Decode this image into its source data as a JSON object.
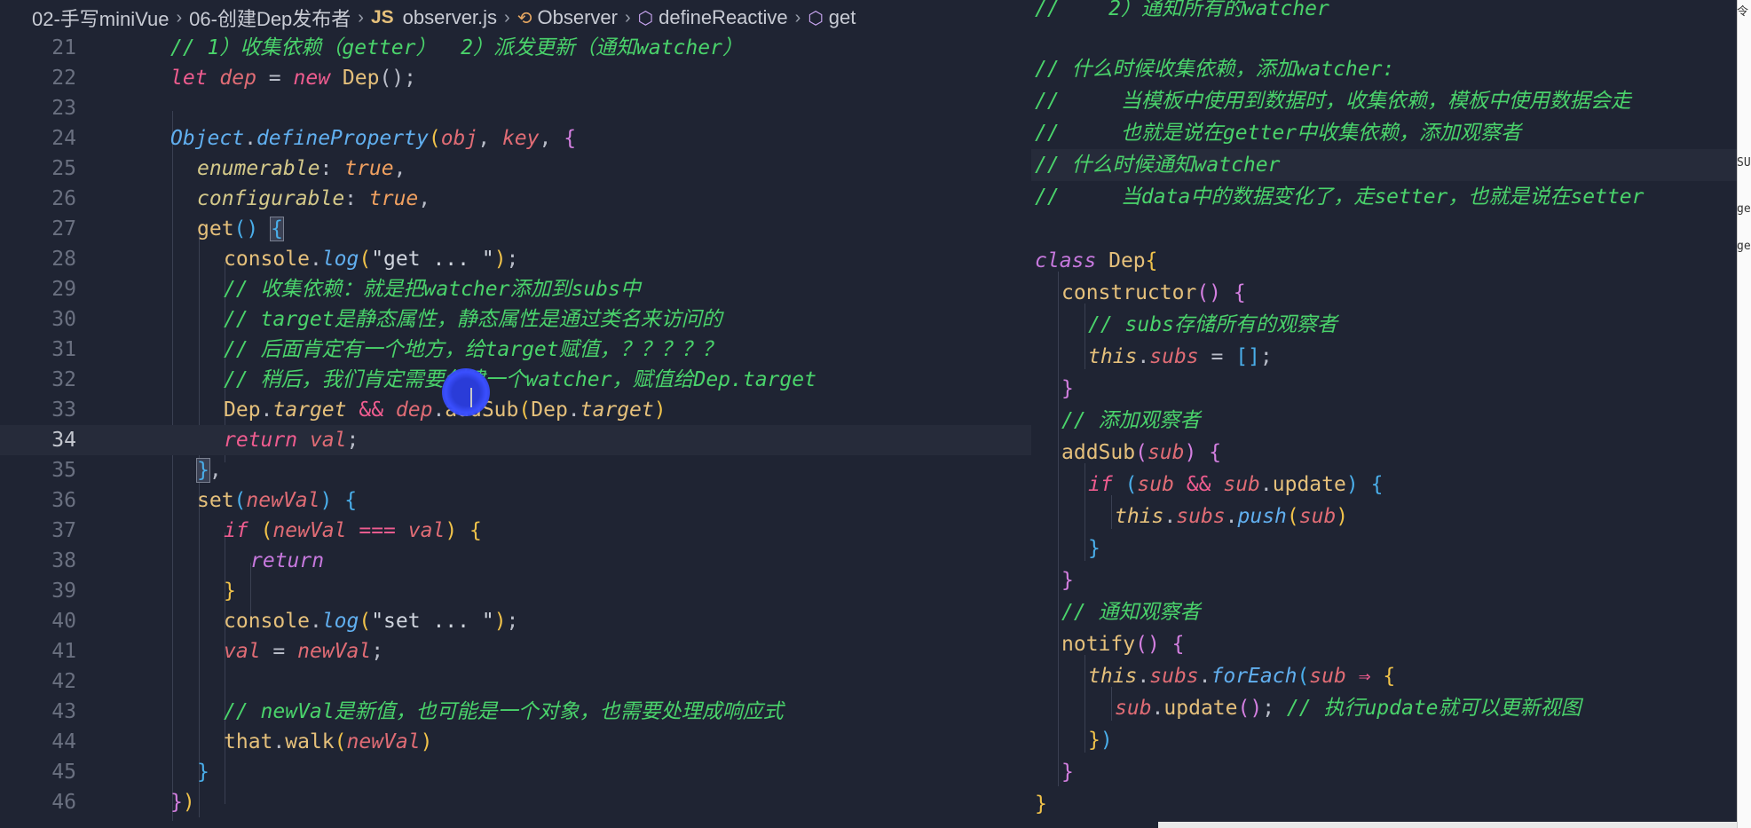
{
  "breadcrumb": {
    "folder1": "02-手写miniVue",
    "folder2": "06-创建Dep发布者",
    "file_badge": "JS",
    "file": "observer.js",
    "symbol1": "Observer",
    "symbol2": "defineReactive",
    "symbol3": "get"
  },
  "left_lines": [
    {
      "num": "21"
    },
    {
      "num": "22"
    },
    {
      "num": "23"
    },
    {
      "num": "24"
    },
    {
      "num": "25"
    },
    {
      "num": "26"
    },
    {
      "num": "27"
    },
    {
      "num": "28"
    },
    {
      "num": "29"
    },
    {
      "num": "30"
    },
    {
      "num": "31"
    },
    {
      "num": "32"
    },
    {
      "num": "33"
    },
    {
      "num": "34"
    },
    {
      "num": "35"
    },
    {
      "num": "36"
    },
    {
      "num": "37"
    },
    {
      "num": "38"
    },
    {
      "num": "39"
    },
    {
      "num": "40"
    },
    {
      "num": "41"
    },
    {
      "num": "42"
    },
    {
      "num": "43"
    },
    {
      "num": "44"
    },
    {
      "num": "45"
    },
    {
      "num": "46"
    }
  ],
  "code_left": {
    "l21_comment": "// 1）收集依赖（getter）  2）派发更新（通知watcher）",
    "l22_let": "let",
    "l22_dep": "dep",
    "l22_eq": " = ",
    "l22_new": "new",
    "l22_cls": "Dep",
    "l22_tail": "();",
    "l24_obj": "Object",
    "l24_dot": ".",
    "l24_fn": "defineProperty",
    "l24_arg1": "obj",
    "l24_comma": ", ",
    "l24_arg2": "key",
    "l25_key": "enumerable",
    "l25_val": "true",
    "l26_key": "configurable",
    "l26_val": "true",
    "l27_fn": "get",
    "l28_obj": "console",
    "l28_fn": "log",
    "l28_str": "\"get ... \"",
    "l29_comment": "// 收集依赖：就是把watcher添加到subs中",
    "l30_comment": "// target是静态属性，静态属性是通过类名来访问的",
    "l31_comment": "// 后面肯定有一个地方，给target赋值，？？？？？",
    "l32_comment": "// 稍后，我们肯定需要创建一个watcher，赋值给Dep.target",
    "l33_cls": "Dep",
    "l33_prop": "target",
    "l33_and": " && ",
    "l33_dep": "dep",
    "l33_fn": "addSub",
    "l33_cls2": "Dep",
    "l33_prop2": "target",
    "l34_kw": "return",
    "l34_val": "val",
    "l36_fn": "set",
    "l36_par": "newVal",
    "l37_kw": "if",
    "l37_a": "newVal",
    "l37_op": " === ",
    "l37_b": "val",
    "l38_kw": "return",
    "l40_obj": "console",
    "l40_fn": "log",
    "l40_str": "\"set ... \"",
    "l41_a": "val",
    "l41_b": "newVal",
    "l43_comment": "// newVal是新值，也可能是一个对象，也需要处理成响应式",
    "l44_obj": "that",
    "l44_fn": "walk",
    "l44_par": "newVal"
  },
  "code_right": {
    "r1_comment": "//    2）通知所有的watcher",
    "r3_comment": "// 什么时候收集依赖，添加watcher:",
    "r4_comment": "//     当模板中使用到数据时，收集依赖，模板中使用数据会走",
    "r5_comment": "//     也就是说在getter中收集依赖，添加观察者",
    "r6_comment": "// 什么时候通知watcher",
    "r7_comment": "//     当data中的数据变化了，走setter，也就是说在setter",
    "r9_kw": "class",
    "r9_cls": "Dep",
    "r10_fn": "constructor",
    "r11_comment": "// subs存储所有的观察者",
    "r12_this": "this",
    "r12_prop": "subs",
    "r14_comment": "// 添加观察者",
    "r15_fn": "addSub",
    "r15_par": "sub",
    "r16_kw": "if",
    "r16_a": "sub",
    "r16_b": "sub",
    "r16_prop": "update",
    "r17_this": "this",
    "r17_prop": "subs",
    "r17_fn": "push",
    "r17_par": "sub",
    "r20_comment": "// 通知观察者",
    "r21_fn": "notify",
    "r22_this": "this",
    "r22_prop": "subs",
    "r22_fn": "forEach",
    "r22_par": "sub",
    "r23_a": "sub",
    "r23_fn": "update",
    "r23_comment": "// 执行update就可以更新视图"
  },
  "edge_fragments": [
    "令",
    "SU",
    "ge",
    "ge"
  ]
}
